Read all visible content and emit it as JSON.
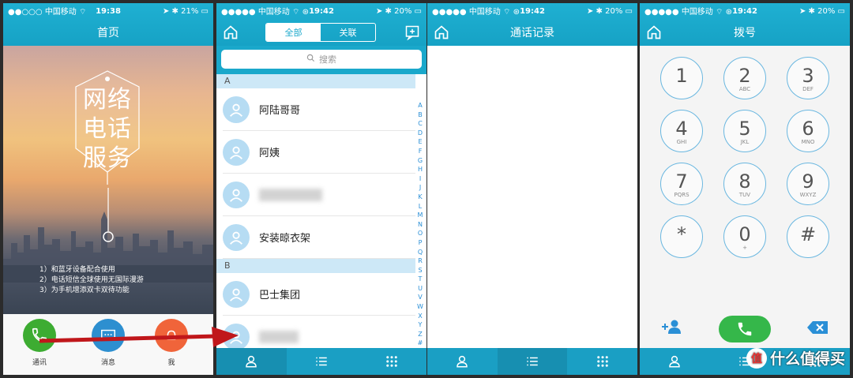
{
  "status": {
    "carrier": "中国移动",
    "battery_1": "21%",
    "battery_2": "20%",
    "time_1": "19:38",
    "time_2": "19:42"
  },
  "screen1": {
    "title": "首页",
    "tag_lines": [
      "网络",
      "电话",
      "服务"
    ],
    "notes": [
      "1）和蓝牙设备配合使用",
      "2）电话短信全球使用无国际漫游",
      "3）为手机增添双卡双待功能"
    ],
    "dock": [
      {
        "label": "通讯",
        "icon": "phone-icon",
        "color": "#3dac32"
      },
      {
        "label": "消息",
        "icon": "message-icon",
        "color": "#2d8fd0"
      },
      {
        "label": "我",
        "icon": "user-icon",
        "color": "#f0643a"
      }
    ]
  },
  "screen2": {
    "segments": [
      "全部",
      "关联"
    ],
    "search_placeholder": "搜索",
    "sections": [
      {
        "header": "A",
        "contacts": [
          "阿陆哥哥",
          "阿姨",
          "",
          "安装晾衣架"
        ]
      },
      {
        "header": "B",
        "contacts": [
          "巴士集团",
          ""
        ]
      }
    ],
    "index": [
      "A",
      "B",
      "C",
      "D",
      "E",
      "F",
      "G",
      "H",
      "I",
      "J",
      "K",
      "L",
      "M",
      "N",
      "O",
      "P",
      "Q",
      "R",
      "S",
      "T",
      "U",
      "V",
      "W",
      "X",
      "Y",
      "Z",
      "#"
    ]
  },
  "screen3": {
    "title": "通话记录"
  },
  "screen4": {
    "title": "拨号",
    "keys": [
      {
        "d": "1",
        "l": ""
      },
      {
        "d": "2",
        "l": "ABC"
      },
      {
        "d": "3",
        "l": "DEF"
      },
      {
        "d": "4",
        "l": "GHI"
      },
      {
        "d": "5",
        "l": "JKL"
      },
      {
        "d": "6",
        "l": "MNO"
      },
      {
        "d": "7",
        "l": "PQRS"
      },
      {
        "d": "8",
        "l": "TUV"
      },
      {
        "d": "9",
        "l": "WXYZ"
      },
      {
        "d": "*",
        "l": ""
      },
      {
        "d": "0",
        "l": "+"
      },
      {
        "d": "#",
        "l": ""
      }
    ]
  },
  "watermark": {
    "badge": "值",
    "text": "什么值得买"
  },
  "colors": {
    "teal": "#1aa8cb",
    "tab_selected": "#178fb1",
    "call_green": "#35b74a",
    "arrow_red": "#c0171b"
  }
}
